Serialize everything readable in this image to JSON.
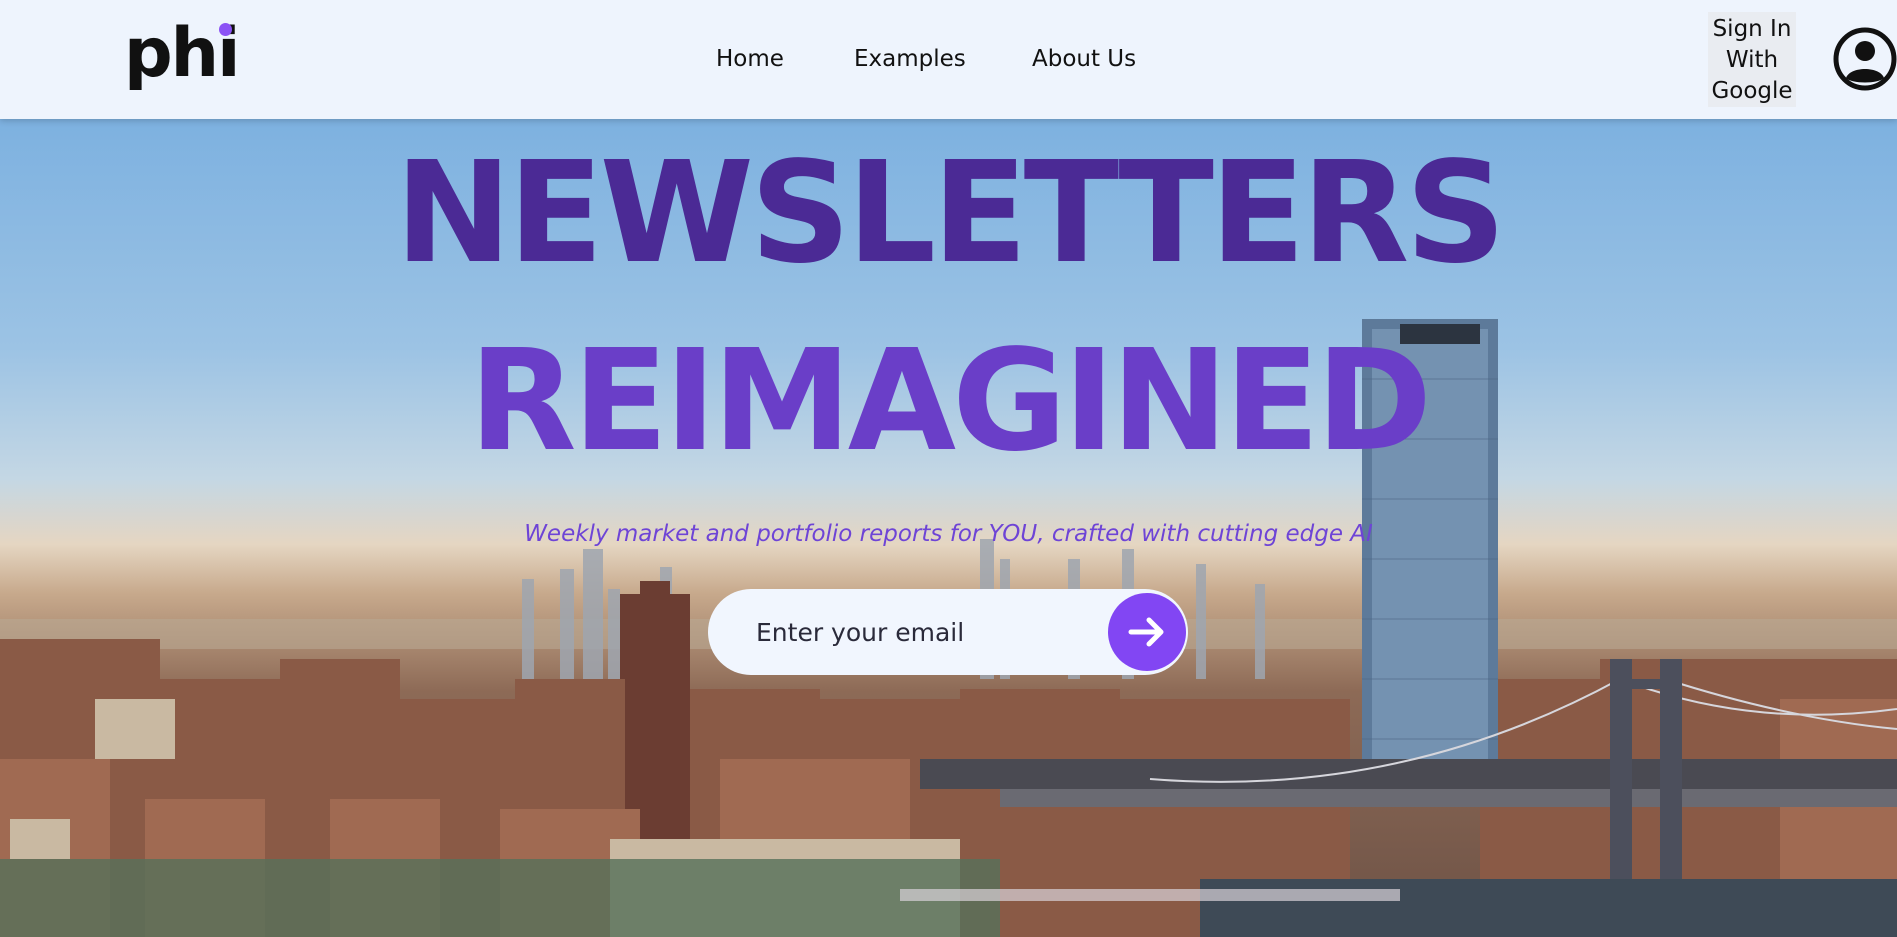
{
  "header": {
    "logo_text": "phi",
    "nav": [
      {
        "label": "Home"
      },
      {
        "label": "Examples"
      },
      {
        "label": "About Us"
      }
    ],
    "signin_label_lines": [
      "Sign In",
      "With",
      "Google"
    ],
    "avatar_icon": "user-circle-icon"
  },
  "hero": {
    "headline_line1": "NEWSLETTERS",
    "headline_line2": "REIMAGINED",
    "tagline": "Weekly market and portfolio reports for YOU, crafted with cutting edge AI",
    "email_placeholder": "Enter your email",
    "submit_icon": "arrow-right-icon"
  },
  "colors": {
    "header_bg": "#eef4fd",
    "accent": "#8246f3",
    "headline_dark": "#4b2a95",
    "headline_light": "#6a3ec8",
    "tagline": "#6e44d6",
    "logo_dot": "#8b52f5"
  }
}
